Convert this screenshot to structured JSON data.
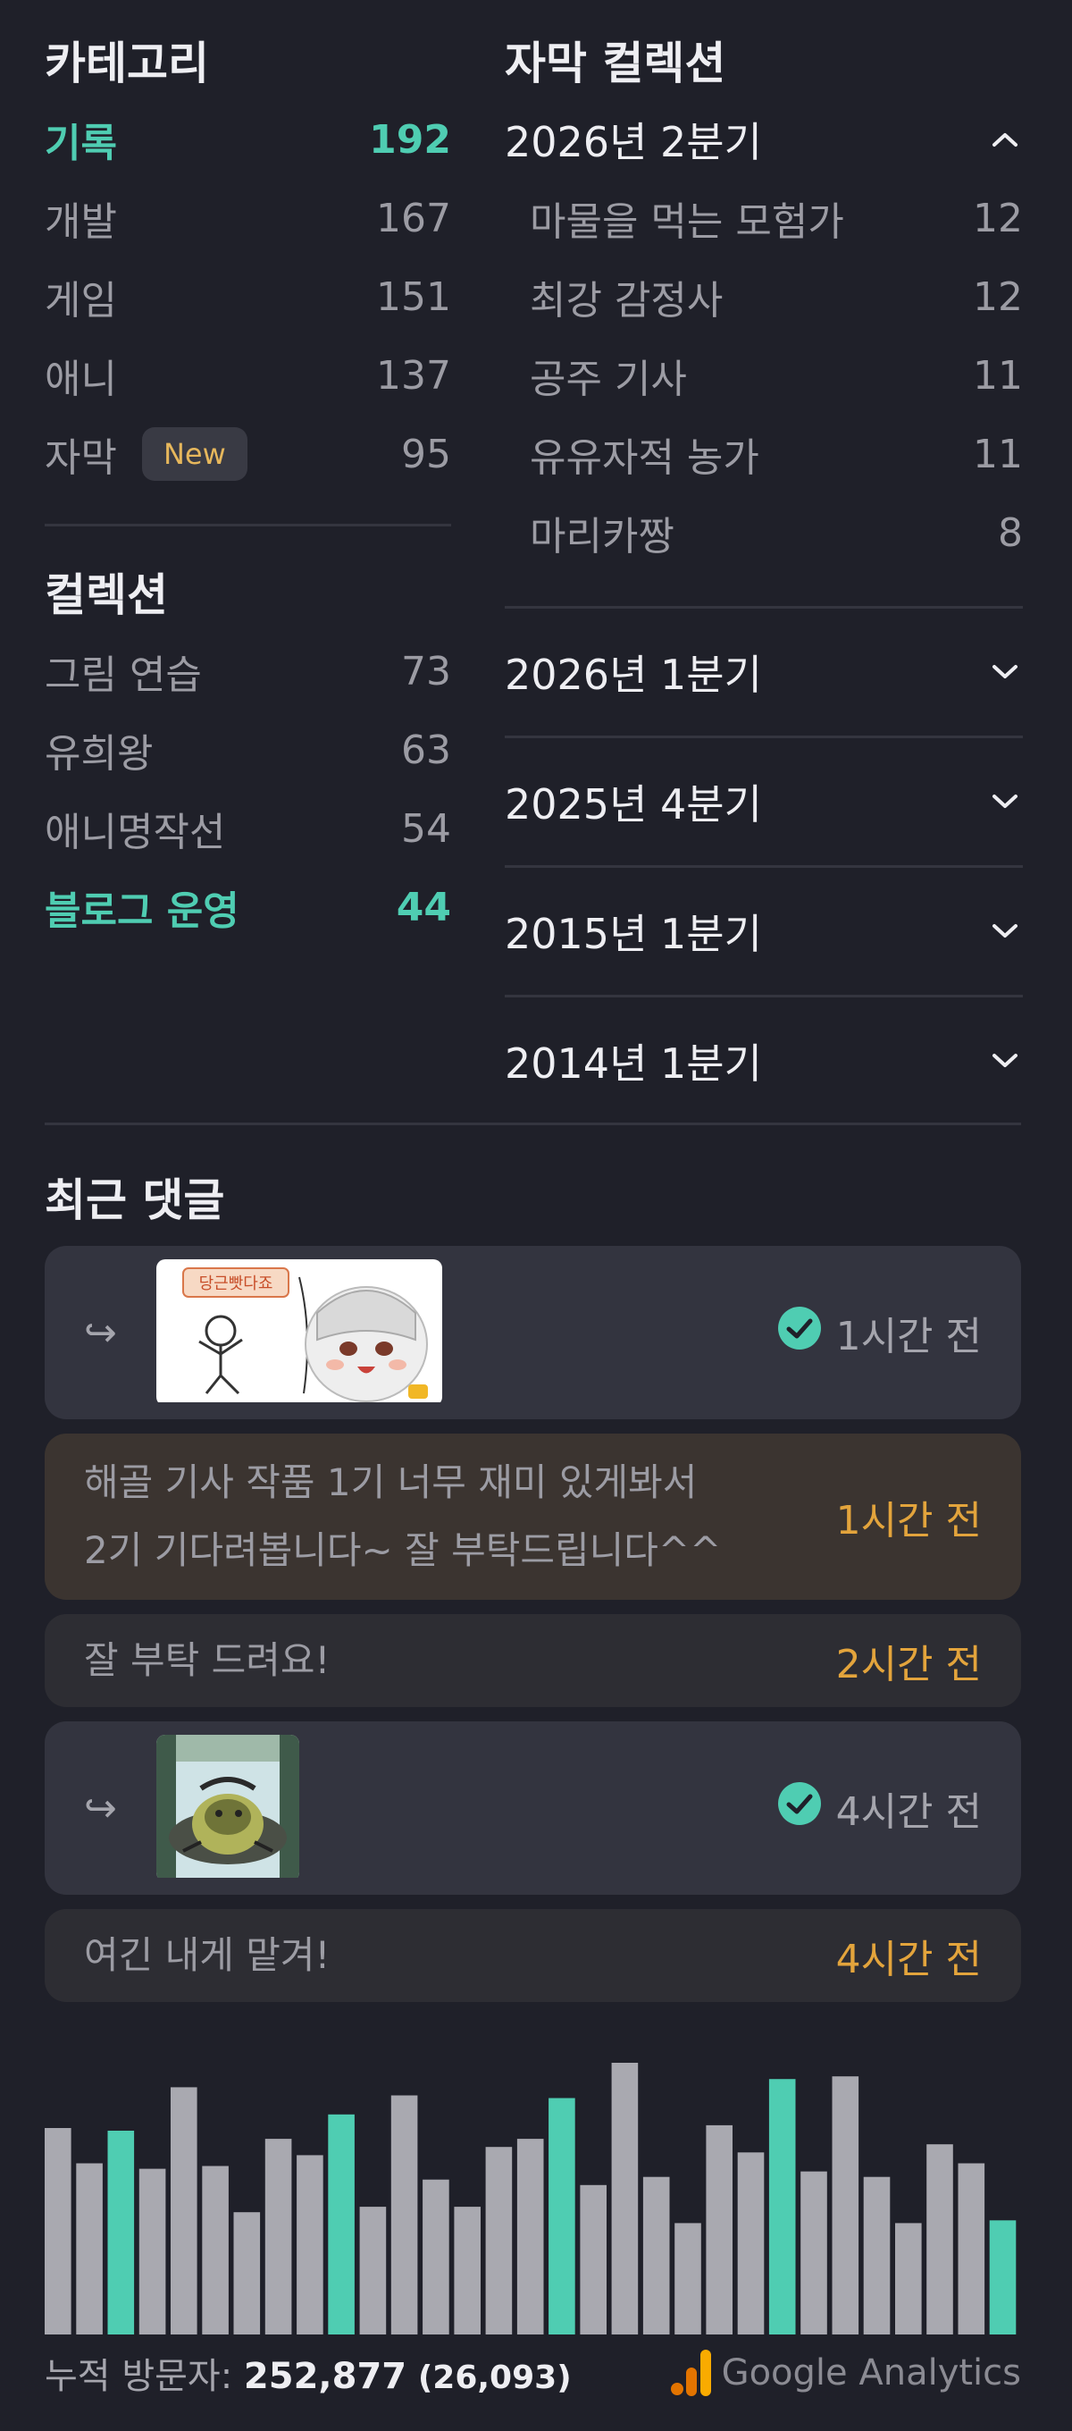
{
  "categories": {
    "title": "카테고리",
    "items": [
      {
        "label": "기록",
        "count": "192"
      },
      {
        "label": "개발",
        "count": "167"
      },
      {
        "label": "게임",
        "count": "151"
      },
      {
        "label": "애니",
        "count": "137"
      },
      {
        "label": "자막",
        "count": "95",
        "badge": "New"
      }
    ]
  },
  "collections": {
    "title": "컬렉션",
    "items": [
      {
        "label": "그림 연습",
        "count": "73"
      },
      {
        "label": "유희왕",
        "count": "63"
      },
      {
        "label": "애니명작선",
        "count": "54"
      },
      {
        "label": "블로그 운영",
        "count": "44"
      }
    ]
  },
  "subtitle_collections": {
    "title": "자막 컬렉션",
    "expanded": {
      "label": "2026년 2분기",
      "items": [
        {
          "label": "마물을 먹는 모험가",
          "count": "12"
        },
        {
          "label": "최강 감정사",
          "count": "12"
        },
        {
          "label": "공주 기사",
          "count": "11"
        },
        {
          "label": "유유자적 농가",
          "count": "11"
        },
        {
          "label": "마리카짱",
          "count": "8"
        }
      ]
    },
    "collapsed": [
      {
        "label": "2026년 1분기"
      },
      {
        "label": "2025년 4분기"
      },
      {
        "label": "2015년 1분기"
      },
      {
        "label": "2014년 1분기"
      }
    ]
  },
  "recent_comments": {
    "title": "최근 댓글",
    "items": [
      {
        "type": "sticker",
        "reply_arrow": "↪",
        "sticker_text": "당근빳다죠",
        "time": "1시간 전"
      },
      {
        "type": "text",
        "text_line1": "해골 기사 작품 1기 너무 재미 있게봐서",
        "text_line2": "2기 기다려봅니다~ 잘 부탁드립니다^^",
        "time": "1시간 전"
      },
      {
        "type": "text",
        "text": "잘 부탁 드려요!",
        "time": "2시간 전"
      },
      {
        "type": "sticker",
        "reply_arrow": "↪",
        "time": "4시간 전"
      },
      {
        "type": "text",
        "text": "여긴 내게 맡겨!",
        "time": "4시간 전"
      }
    ]
  },
  "chart_data": {
    "type": "bar",
    "values": [
      0.76,
      0.63,
      0.75,
      0.61,
      0.91,
      0.62,
      0.45,
      0.72,
      0.66,
      0.81,
      0.47,
      0.88,
      0.57,
      0.47,
      0.69,
      0.72,
      0.87,
      0.55,
      1.0,
      0.58,
      0.41,
      0.77,
      0.67,
      0.94,
      0.6,
      0.95,
      0.58,
      0.41,
      0.7,
      0.63,
      0.42
    ],
    "highlight": [
      false,
      false,
      true,
      false,
      false,
      false,
      false,
      false,
      false,
      true,
      false,
      false,
      false,
      false,
      false,
      false,
      true,
      false,
      false,
      false,
      false,
      false,
      false,
      true,
      false,
      false,
      false,
      false,
      false,
      false,
      true
    ],
    "colors": {
      "normal": "#a9a9b0",
      "highlight": "#4fcdb2"
    }
  },
  "visitors": {
    "label": "누적 방문자:",
    "total": "252,877",
    "today": "(26,093)",
    "brand": "Google Analytics"
  },
  "colors": {
    "accent": "#4fcdb2",
    "time": "#e3a43c"
  }
}
